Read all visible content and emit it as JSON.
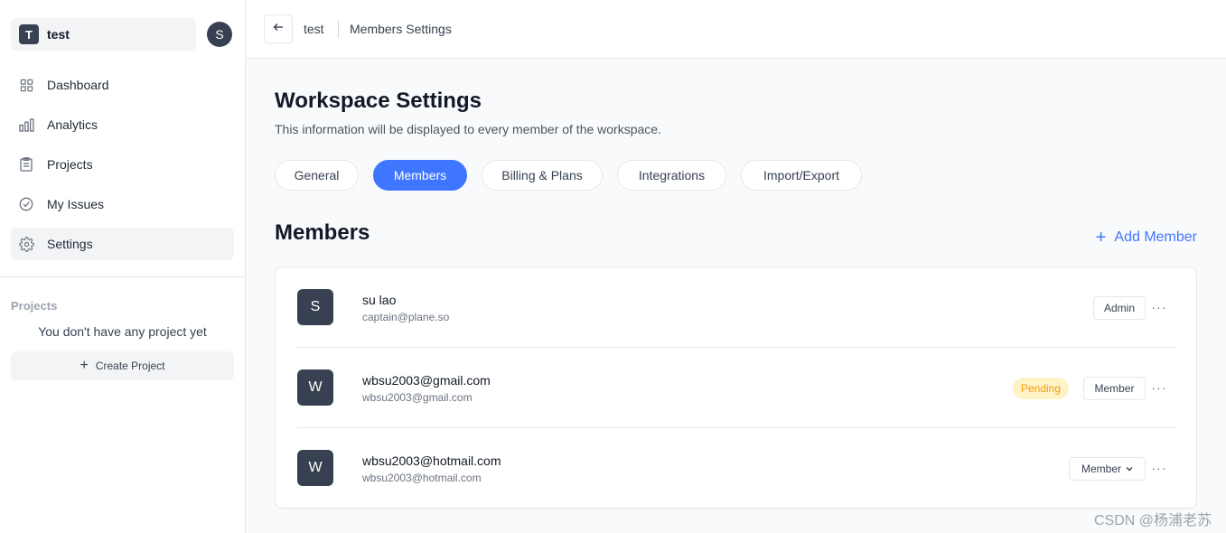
{
  "workspace": {
    "badge": "T",
    "name": "test",
    "user_initial": "S"
  },
  "sidebar": {
    "items": [
      {
        "label": "Dashboard",
        "icon": "grid-icon"
      },
      {
        "label": "Analytics",
        "icon": "bar-chart-icon"
      },
      {
        "label": "Projects",
        "icon": "clipboard-icon"
      },
      {
        "label": "My Issues",
        "icon": "check-circle-icon"
      },
      {
        "label": "Settings",
        "icon": "gear-icon",
        "active": true
      }
    ],
    "projects_heading": "Projects",
    "projects_empty": "You don't have any project yet",
    "create_project_label": "Create Project"
  },
  "header": {
    "back_icon": "arrow-left-icon",
    "crumb_workspace": "test",
    "crumb_page": "Members Settings"
  },
  "main": {
    "title": "Workspace Settings",
    "subtitle": "This information will be displayed to every member of the workspace.",
    "tabs": [
      {
        "label": "General"
      },
      {
        "label": "Members",
        "active": true
      },
      {
        "label": "Billing & Plans"
      },
      {
        "label": "Integrations"
      },
      {
        "label": "Import/Export"
      }
    ],
    "members_title": "Members",
    "add_member_label": "Add Member",
    "members": [
      {
        "initial": "S",
        "name": "su lao",
        "email": "captain@plane.so",
        "role": "Admin",
        "status": ""
      },
      {
        "initial": "W",
        "name": "wbsu2003@gmail.com",
        "email": "wbsu2003@gmail.com",
        "role": "Member",
        "status": "Pending"
      },
      {
        "initial": "W",
        "name": "wbsu2003@hotmail.com",
        "email": "wbsu2003@hotmail.com",
        "role": "Member",
        "status": ""
      }
    ],
    "more_label": "···"
  },
  "watermark": "CSDN @杨浦老苏",
  "colors": {
    "accent": "#3f76ff",
    "dark_avatar": "#374151",
    "pending_bg": "#fef3c7",
    "pending_text": "#f59e0b"
  }
}
